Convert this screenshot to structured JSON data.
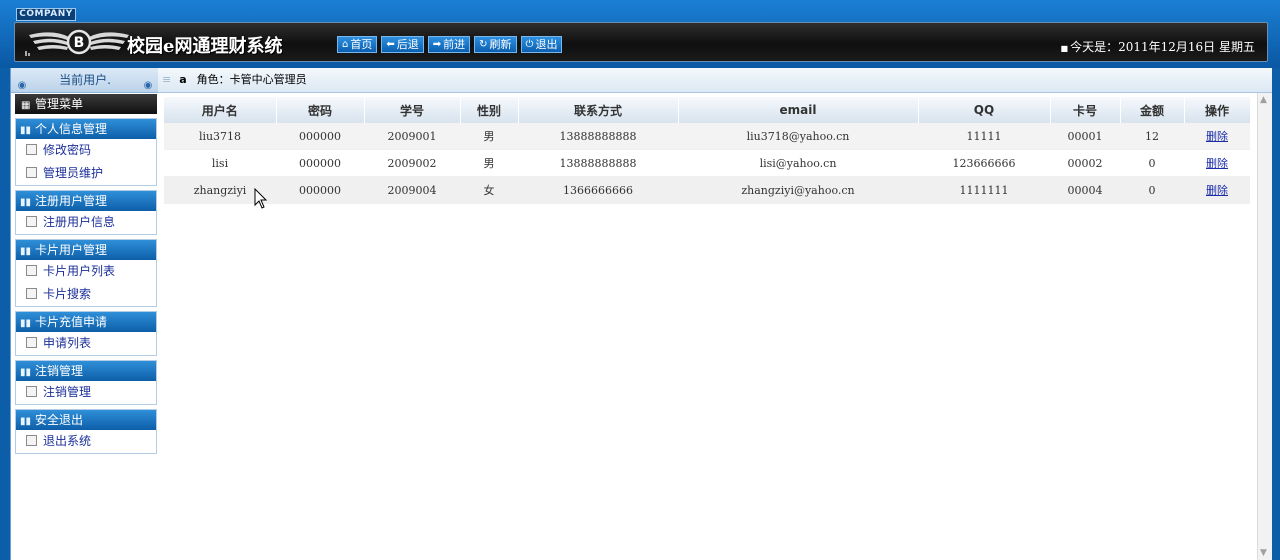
{
  "header": {
    "company": "COMPANY",
    "system_title": "校园e网通理财系统",
    "nav": [
      {
        "icon": "home-icon",
        "glyph": "⌂",
        "label": "首页"
      },
      {
        "icon": "back-icon",
        "glyph": "⬅",
        "label": "后退"
      },
      {
        "icon": "forward-icon",
        "glyph": "➡",
        "label": "前进"
      },
      {
        "icon": "refresh-icon",
        "glyph": "↻",
        "label": "刷新"
      },
      {
        "icon": "power-icon",
        "glyph": "⏻",
        "label": "退出"
      }
    ],
    "date_text": "今天是：2011年12月16日 星期五"
  },
  "sidebar": {
    "current_user_label": "当前用户.",
    "menu_title": "管理菜单",
    "groups": [
      {
        "title": "个人信息管理",
        "items": [
          "修改密码",
          "管理员维护"
        ]
      },
      {
        "title": "注册用户管理",
        "items": [
          "注册用户信息"
        ]
      },
      {
        "title": "卡片用户管理",
        "items": [
          "卡片用户列表",
          "卡片搜索"
        ]
      },
      {
        "title": "卡片充值申请",
        "items": [
          "申请列表"
        ]
      },
      {
        "title": "注销管理",
        "items": [
          "注销管理"
        ]
      },
      {
        "title": "安全退出",
        "items": [
          "退出系统"
        ]
      }
    ]
  },
  "breadcrumb": {
    "user": "a",
    "role": "角色：卡管中心管理员"
  },
  "table": {
    "headers": [
      "用户名",
      "密码",
      "学号",
      "性别",
      "联系方式",
      "email",
      "QQ",
      "卡号",
      "金额",
      "操作"
    ],
    "rows": [
      [
        "liu3718",
        "000000",
        "2009001",
        "男",
        "13888888888",
        "liu3718@yahoo.cn",
        "11111",
        "00001",
        "12",
        "删除"
      ],
      [
        "lisi",
        "000000",
        "2009002",
        "男",
        "13888888888",
        "lisi@yahoo.cn",
        "123666666",
        "00002",
        "0",
        "删除"
      ],
      [
        "zhangziyi",
        "000000",
        "2009004",
        "女",
        "1366666666",
        "zhangziyi@yahoo.cn",
        "1111111",
        "00004",
        "0",
        "删除"
      ]
    ]
  }
}
